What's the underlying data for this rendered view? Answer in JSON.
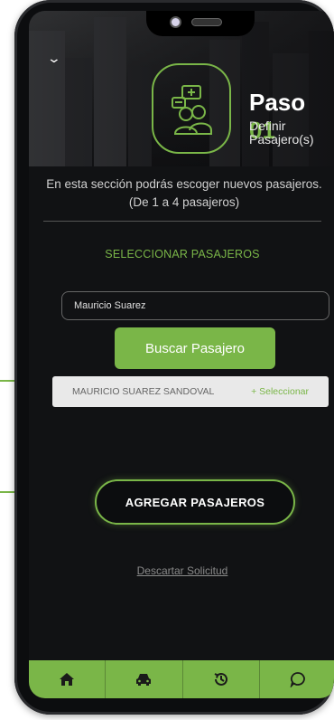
{
  "header": {
    "step_word": "Paso",
    "step_number": "01",
    "step_subtitle": "Definir Pasajero(s)"
  },
  "description": "En esta sección podrás escoger nuevos pasajeros. (De 1 a 4 pasajeros)",
  "select_section_title": "SELECCIONAR PASAJEROS",
  "search": {
    "value": "Mauricio Suarez"
  },
  "search_button_label": "Buscar Pasajero",
  "results": [
    {
      "name": "MAURICIO SUAREZ SANDOVAL",
      "action": "+ Seleccionar"
    }
  ],
  "add_button_label": "AGREGAR PASAJEROS",
  "discard_link": "Descartar Solicitud",
  "bottom_nav": [
    "home-icon",
    "car-icon",
    "history-icon",
    "chat-icon"
  ],
  "colors": {
    "accent": "#7ab648",
    "background": "#111214",
    "result_row": "#e9e9e9"
  }
}
